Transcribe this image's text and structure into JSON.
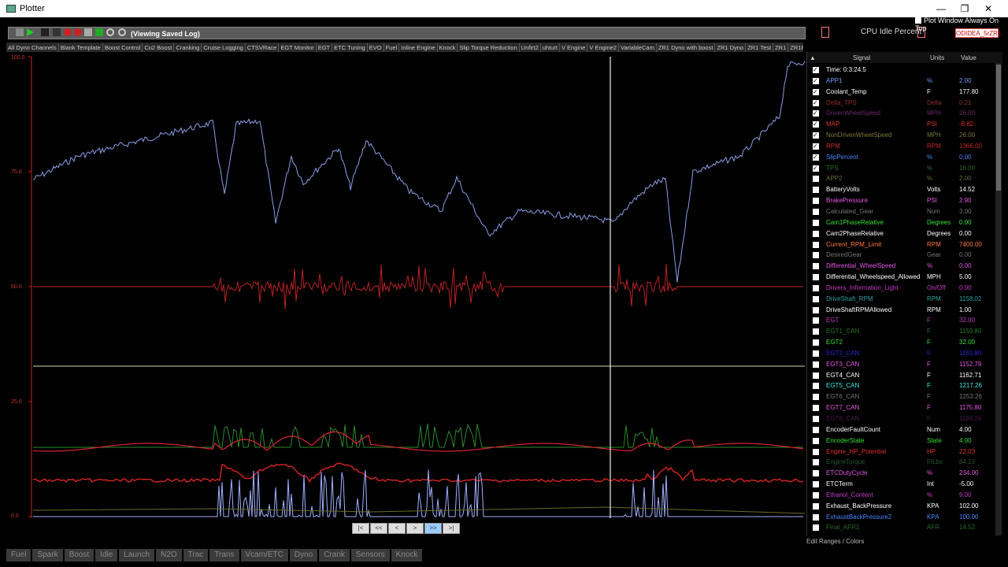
{
  "window": {
    "title": "Plotter",
    "minimize": "—",
    "restore": "❐",
    "close": "✕"
  },
  "toolbar": {
    "viewing_label": "(Viewing Saved Log)",
    "cpu_idle_label": "CPU Idle Percent",
    "on_top_label": "Plot Window Always On Top",
    "device_label": "ODIDEA_5rZR1"
  },
  "layout_tabs": [
    "All Dyno Channels",
    "Blank Template",
    "Boost Control",
    "Co2 Boost",
    "Cranking",
    "Cruise Logging",
    "CTSVRace",
    "EGT Monitor",
    "EGT",
    "ETC Tuning",
    "EVO",
    "Fuel",
    "Inline Engine",
    "Knock",
    "Slip Torque Reduction",
    "Unfirt2",
    "uhturt",
    "V Engine",
    "V Engine2",
    "VariableCam",
    "ZR1 Dyno with boost",
    "ZR1 Dyno",
    "ZR1 Test",
    "ZR1",
    "ZR1Race",
    "Save As..."
  ],
  "plot": {
    "y_ticks": [
      "100.0",
      "75.0",
      "50.0",
      "25.0",
      "0.0"
    ],
    "nav_buttons": [
      "|<",
      "<<",
      "<",
      ">",
      ">>",
      ">|"
    ]
  },
  "bottom_tabs": [
    "Fuel",
    "Spark",
    "Boost",
    "Idle",
    "Launch",
    "N2O",
    "Trac",
    "Trans",
    "Vcam/ETC",
    "Dyno",
    "Crank",
    "Sensors",
    "Knock"
  ],
  "signal_panel": {
    "headers": {
      "signal": "Signal",
      "units": "Units",
      "value": "Value"
    },
    "time_label": "Time: 0:3:24.5",
    "rows": [
      {
        "name": "APP1",
        "unit": "%",
        "value": "2.00",
        "color": "#6e9eff",
        "checked": true
      },
      {
        "name": "Coolant_Temp",
        "unit": "F",
        "value": "177.80",
        "color": "#ffffff",
        "checked": true
      },
      {
        "name": "Delta_TPS",
        "unit": "Delta",
        "value": "0.21",
        "color": "#9a2a2a",
        "checked": true
      },
      {
        "name": "DrivenWheelSpeed",
        "unit": "MPH",
        "value": "26.00",
        "color": "#6a2a6a",
        "checked": true
      },
      {
        "name": "MAP",
        "unit": "PSI",
        "value": "-8.82",
        "color": "#e03030",
        "checked": true
      },
      {
        "name": "NonDrivenWheelSpeed",
        "unit": "MPH",
        "value": "26.00",
        "color": "#7a7a3a",
        "checked": true
      },
      {
        "name": "RPM",
        "unit": "RPM",
        "value": "1366.00",
        "color": "#c82828",
        "checked": true
      },
      {
        "name": "SlipPercent",
        "unit": "%",
        "value": "0.00",
        "color": "#4a88ff",
        "checked": true
      },
      {
        "name": "TPS",
        "unit": "%",
        "value": "16.00",
        "color": "#2a6a2a",
        "checked": true
      },
      {
        "name": "APP2",
        "unit": "%",
        "value": "2.00",
        "color": "#6a6a3a",
        "checked": false
      },
      {
        "name": "BatteryVolts",
        "unit": "Volts",
        "value": "14.52",
        "color": "#ffffff",
        "checked": false
      },
      {
        "name": "BrakePressure",
        "unit": "PSI",
        "value": "2.90",
        "color": "#e858e8",
        "checked": false
      },
      {
        "name": "Calculated_Gear",
        "unit": "Num",
        "value": "3.00",
        "color": "#777777",
        "checked": false
      },
      {
        "name": "Cam1PhaseRelative",
        "unit": "Degrees",
        "value": "0.00",
        "color": "#38e038",
        "checked": false
      },
      {
        "name": "Cam2PhaseRelative",
        "unit": "Degrees",
        "value": "0.00",
        "color": "#ffffff",
        "checked": false
      },
      {
        "name": "Current_RPM_Limit",
        "unit": "RPM",
        "value": "7400.00",
        "color": "#ff7a3a",
        "checked": false
      },
      {
        "name": "DesiredGear",
        "unit": "Gear",
        "value": "0.00",
        "color": "#777777",
        "checked": false
      },
      {
        "name": "Differential_WheelSpeed",
        "unit": "%",
        "value": "0.00",
        "color": "#e858e8",
        "checked": false
      },
      {
        "name": "Differential_Wheelspeed_Allowed",
        "unit": "MPH",
        "value": "5.00",
        "color": "#ffffff",
        "checked": false
      },
      {
        "name": "Drivers_Information_Light",
        "unit": "On/Off",
        "value": "0.00",
        "color": "#c838c8",
        "checked": false
      },
      {
        "name": "DriveShaft_RPM",
        "unit": "RPM",
        "value": "1158.02",
        "color": "#2aa0a0",
        "checked": false
      },
      {
        "name": "DriveShaftRPMAllowed",
        "unit": "RPM",
        "value": "1.00",
        "color": "#ffffff",
        "checked": false
      },
      {
        "name": "EGT",
        "unit": "F",
        "value": "32.00",
        "color": "#c838c8",
        "checked": false
      },
      {
        "name": "EGT1_CAN",
        "unit": "F",
        "value": "1159.80",
        "color": "#2a7a2a",
        "checked": false
      },
      {
        "name": "EGT2",
        "unit": "F",
        "value": "32.00",
        "color": "#38e038",
        "checked": false
      },
      {
        "name": "EGT2_CAN",
        "unit": "F",
        "value": "1155.80",
        "color": "#2a2ad0",
        "checked": false
      },
      {
        "name": "EGT3_CAN",
        "unit": "F",
        "value": "1152.79",
        "color": "#e858e8",
        "checked": false
      },
      {
        "name": "EGT4_CAN",
        "unit": "F",
        "value": "1162.71",
        "color": "#ffffff",
        "checked": false
      },
      {
        "name": "EGT5_CAN",
        "unit": "F",
        "value": "1217.26",
        "color": "#38e8e8",
        "checked": false
      },
      {
        "name": "EGT6_CAN",
        "unit": "F",
        "value": "1253.26",
        "color": "#777777",
        "checked": false
      },
      {
        "name": "EGT7_CAN",
        "unit": "F",
        "value": "1175.80",
        "color": "#e858e8",
        "checked": false
      },
      {
        "name": "EGT8_CAN",
        "unit": "F",
        "value": "1199.26",
        "color": "#4a1a4a",
        "checked": false
      },
      {
        "name": "EncoderFaultCount",
        "unit": "Num",
        "value": "4.00",
        "color": "#ffffff",
        "checked": false
      },
      {
        "name": "EncoderState",
        "unit": "State",
        "value": "4.00",
        "color": "#38e038",
        "checked": false
      },
      {
        "name": "Engine_HP_Potential",
        "unit": "HP",
        "value": "22.03",
        "color": "#e03030",
        "checked": false
      },
      {
        "name": "EngineTorque",
        "unit": "FtLbs",
        "value": "84.13",
        "color": "#2a5a2a",
        "checked": false
      },
      {
        "name": "ETCDutyCycle",
        "unit": "%",
        "value": "234.00",
        "color": "#e858e8",
        "checked": false
      },
      {
        "name": "ETCTerm",
        "unit": "Int",
        "value": "-5.00",
        "color": "#ffffff",
        "checked": false
      },
      {
        "name": "Ethanol_Content",
        "unit": "%",
        "value": "9.00",
        "color": "#c838c8",
        "checked": false
      },
      {
        "name": "Exhaust_BackPressure",
        "unit": "KPA",
        "value": "102.00",
        "color": "#ffffff",
        "checked": false
      },
      {
        "name": "ExhaustBackPressure2",
        "unit": "KPA",
        "value": "100.00",
        "color": "#4a88ff",
        "checked": false
      },
      {
        "name": "Final_AFR1",
        "unit": "AFR",
        "value": "14.52",
        "color": "#2a6a2a",
        "checked": false
      }
    ],
    "edit_ranges_label": "Edit Ranges / Colors"
  }
}
